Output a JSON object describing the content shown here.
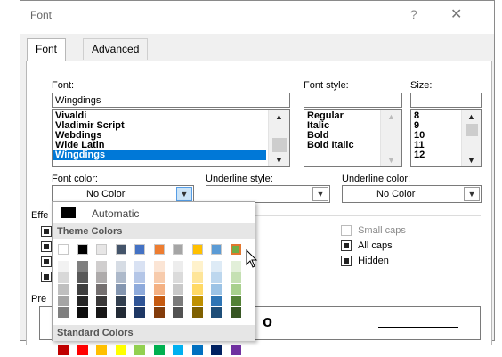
{
  "dialog": {
    "title": "Font",
    "help": "?",
    "close": "✕"
  },
  "tabs": [
    {
      "label": "Font"
    },
    {
      "label": "Advanced"
    }
  ],
  "font": {
    "label": "Font:",
    "value": "Wingdings",
    "list": [
      "Vivaldi",
      "Vladimir Script",
      "Webdings",
      "Wide Latin",
      "Wingdings"
    ]
  },
  "style": {
    "label": "Font style:",
    "value": "",
    "list": [
      "Regular",
      "Italic",
      "Bold",
      "Bold Italic"
    ]
  },
  "size": {
    "label": "Size:",
    "value": "",
    "list": [
      "8",
      "9",
      "10",
      "11",
      "12"
    ]
  },
  "font_color": {
    "label": "Font color:",
    "value": "No Color"
  },
  "underline_style": {
    "label": "Underline style:",
    "value": ""
  },
  "underline_color": {
    "label": "Underline color:",
    "value": "No Color"
  },
  "effects": {
    "label_fragment": "Effe",
    "small_caps": "Small caps",
    "all_caps": "All caps",
    "hidden": "Hidden"
  },
  "preview": {
    "label_fragment": "Pre",
    "sample": "o"
  },
  "color_popup": {
    "automatic": "Automatic",
    "theme_header": "Theme Colors",
    "standard_header": "Standard Colors",
    "theme_row": [
      "#ffffff",
      "#000000",
      "#e7e6e6",
      "#44546a",
      "#4472c4",
      "#ed7d31",
      "#a5a5a5",
      "#ffc000",
      "#5b9bd5",
      "#70ad47"
    ],
    "theme_shades": [
      [
        "#f2f2f2",
        "#7f7f7f",
        "#d0cece",
        "#d6dce4",
        "#d9e2f3",
        "#fbe5d5",
        "#ededed",
        "#fff2cc",
        "#deebf6",
        "#e2efd9"
      ],
      [
        "#d8d8d8",
        "#595959",
        "#aeabab",
        "#adb9ca",
        "#b4c6e7",
        "#f7cbac",
        "#dbdbdb",
        "#fee599",
        "#bdd7ee",
        "#c5e0b3"
      ],
      [
        "#bfbfbf",
        "#3f3f3f",
        "#757070",
        "#8496b0",
        "#8eaadb",
        "#f4b183",
        "#c9c9c9",
        "#ffd965",
        "#9cc3e5",
        "#a8d08d"
      ],
      [
        "#a5a5a5",
        "#262626",
        "#3a3838",
        "#323f4f",
        "#2f5496",
        "#c55a11",
        "#7b7b7b",
        "#bf9000",
        "#2e75b5",
        "#538135"
      ],
      [
        "#7f7f7f",
        "#0d0d0d",
        "#171616",
        "#222a35",
        "#1e3764",
        "#833c0b",
        "#525252",
        "#7f6000",
        "#1e4e79",
        "#375623"
      ]
    ],
    "standard_row": [
      "#c00000",
      "#ff0000",
      "#ffc000",
      "#ffff00",
      "#92d050",
      "#00b050",
      "#00b0f0",
      "#0070c0",
      "#002060",
      "#7030a0"
    ],
    "automatic_color": "#000000",
    "selected_color": "#70ad47"
  }
}
